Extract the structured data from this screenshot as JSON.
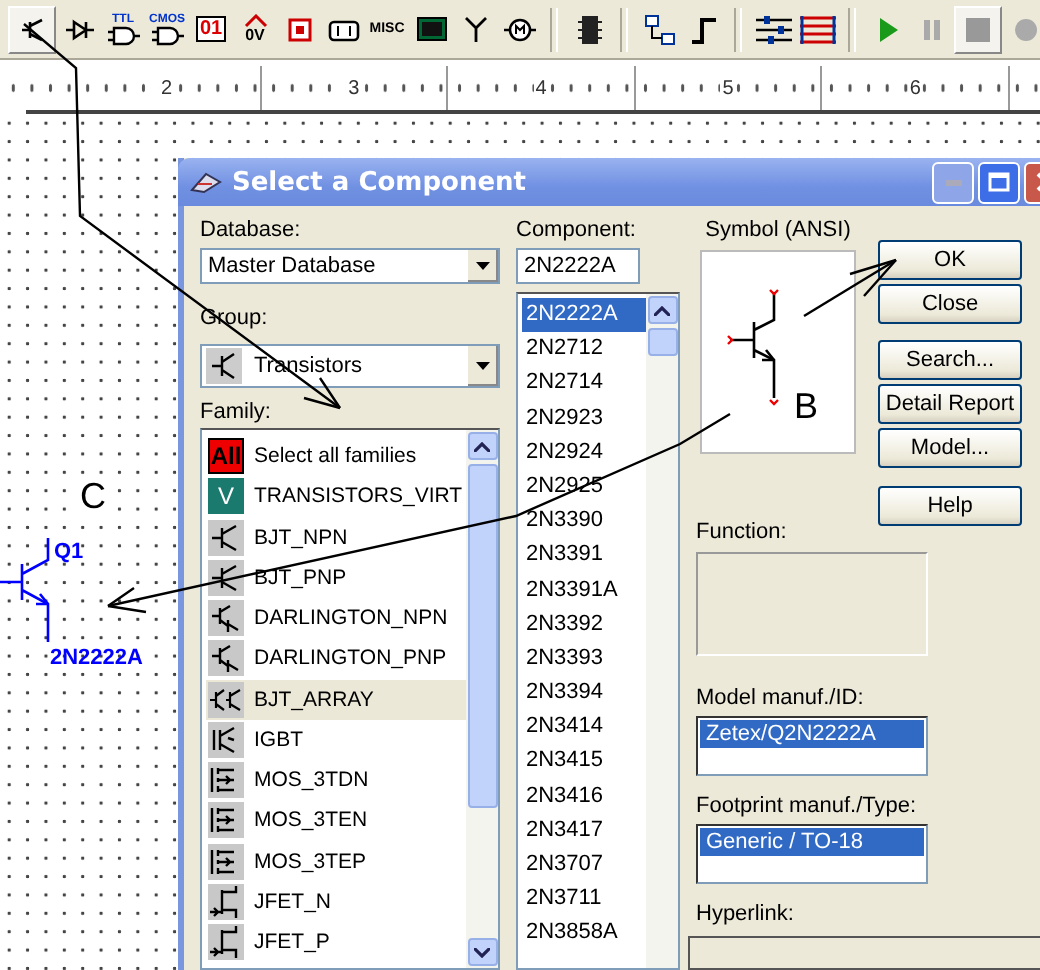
{
  "toolbar": {
    "items": [
      {
        "kind": "transistor",
        "selected": true
      },
      {
        "kind": "diode",
        "selected": false
      },
      {
        "kind": "gate",
        "label": "TTL",
        "selected": false
      },
      {
        "kind": "gate",
        "label": "CMOS",
        "selected": false
      },
      {
        "kind": "digit",
        "label": "01",
        "selected": false
      },
      {
        "kind": "power",
        "label": "0V",
        "selected": false
      },
      {
        "kind": "ic",
        "selected": false
      },
      {
        "kind": "battery",
        "selected": false
      },
      {
        "kind": "text",
        "label": "MISC",
        "selected": false
      },
      {
        "kind": "display",
        "selected": false
      },
      {
        "kind": "antenna",
        "selected": false
      },
      {
        "kind": "motor",
        "selected": false
      },
      {
        "kind": "separator"
      },
      {
        "kind": "chip",
        "selected": false
      },
      {
        "kind": "separator"
      },
      {
        "kind": "hierarchy",
        "selected": false
      },
      {
        "kind": "step",
        "selected": false
      },
      {
        "kind": "separator"
      },
      {
        "kind": "sliders",
        "selected": false
      },
      {
        "kind": "bus",
        "selected": false
      },
      {
        "kind": "separator"
      },
      {
        "kind": "play",
        "selected": false
      },
      {
        "kind": "pause",
        "selected": false
      },
      {
        "kind": "stop",
        "selected": true
      },
      {
        "kind": "record",
        "selected": false
      }
    ]
  },
  "ruler": {
    "marks": [
      "2",
      "3",
      "4",
      "5",
      "6"
    ]
  },
  "canvas": {
    "callout": "C",
    "part": {
      "ref": "Q1",
      "value": "2N2222A"
    }
  },
  "dialog": {
    "title": "Select a Component",
    "database": {
      "label": "Database:",
      "value": "Master Database"
    },
    "group": {
      "label": "Group:",
      "value": "Transistors"
    },
    "family": {
      "label": "Family:",
      "items": [
        {
          "kind": "all",
          "icon_text": "All",
          "text": "Select all families",
          "selected": false
        },
        {
          "kind": "virtual",
          "icon_text": "V",
          "text": "TRANSISTORS_VIRT",
          "selected": false
        },
        {
          "kind": "bjt",
          "text": "BJT_NPN",
          "selected": false
        },
        {
          "kind": "bjt",
          "text": "BJT_PNP",
          "selected": false
        },
        {
          "kind": "darlington",
          "text": "DARLINGTON_NPN",
          "selected": false
        },
        {
          "kind": "darlington",
          "text": "DARLINGTON_PNP",
          "selected": false
        },
        {
          "kind": "array",
          "text": "BJT_ARRAY",
          "selected": true
        },
        {
          "kind": "igbt",
          "text": "IGBT",
          "selected": false
        },
        {
          "kind": "mos",
          "text": "MOS_3TDN",
          "selected": false
        },
        {
          "kind": "mos",
          "text": "MOS_3TEN",
          "selected": false
        },
        {
          "kind": "mos",
          "text": "MOS_3TEP",
          "selected": false
        },
        {
          "kind": "jfet",
          "text": "JFET_N",
          "selected": false
        },
        {
          "kind": "jfet",
          "text": "JFET_P",
          "selected": false
        }
      ]
    },
    "component": {
      "label": "Component:",
      "value": "2N2222A",
      "items": [
        {
          "text": "2N2222A",
          "selected": true
        },
        {
          "text": "2N2712",
          "selected": false
        },
        {
          "text": "2N2714",
          "selected": false
        },
        {
          "text": "2N2923",
          "selected": false
        },
        {
          "text": "2N2924",
          "selected": false
        },
        {
          "text": "2N2925",
          "selected": false
        },
        {
          "text": "2N3390",
          "selected": false
        },
        {
          "text": "2N3391",
          "selected": false
        },
        {
          "text": "2N3391A",
          "selected": false
        },
        {
          "text": "2N3392",
          "selected": false
        },
        {
          "text": "2N3393",
          "selected": false
        },
        {
          "text": "2N3394",
          "selected": false
        },
        {
          "text": "2N3414",
          "selected": false
        },
        {
          "text": "2N3415",
          "selected": false
        },
        {
          "text": "2N3416",
          "selected": false
        },
        {
          "text": "2N3417",
          "selected": false
        },
        {
          "text": "2N3707",
          "selected": false
        },
        {
          "text": "2N3711",
          "selected": false
        },
        {
          "text": "2N3858A",
          "selected": false
        }
      ]
    },
    "symbol": {
      "label": "Symbol (ANSI)",
      "callout": "B"
    },
    "buttons": [
      {
        "label": "OK"
      },
      {
        "label": "Close"
      },
      {
        "label": "Search..."
      },
      {
        "label": "Detail Report"
      },
      {
        "label": "Model..."
      },
      {
        "label": "Help"
      }
    ],
    "function": {
      "label": "Function:"
    },
    "model": {
      "label": "Model manuf./ID:",
      "items": [
        {
          "text": "Zetex/Q2N2222A",
          "selected": true
        }
      ]
    },
    "footprint": {
      "label": "Footprint manuf./Type:",
      "items": [
        {
          "text": "Generic / TO-18",
          "selected": true
        }
      ]
    },
    "hyperlink": {
      "label": "Hyperlink:"
    }
  }
}
